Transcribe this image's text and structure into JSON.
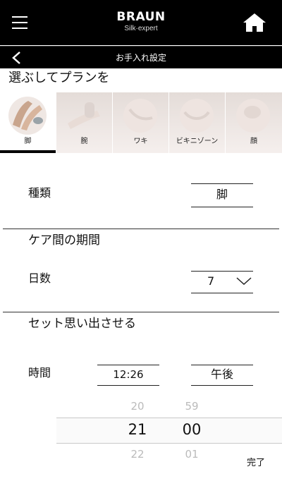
{
  "header": {
    "brand_logo": "BRAUN",
    "brand_sub": "Silk·expert",
    "subtitle": "お手入れ設定"
  },
  "plan": {
    "title": "選ぶしてプランを",
    "tabs": [
      {
        "label": "脚",
        "icon": "leg-icon",
        "active": true
      },
      {
        "label": "腕",
        "icon": "arm-icon",
        "active": false
      },
      {
        "label": "ワキ",
        "icon": "underarm-icon",
        "active": false
      },
      {
        "label": "ビキニゾーン",
        "icon": "bikini-icon",
        "active": false
      },
      {
        "label": "顔",
        "icon": "face-icon",
        "active": false
      }
    ]
  },
  "type_row": {
    "label": "種類",
    "value": "脚"
  },
  "interval": {
    "title": "ケア間の期間",
    "days_label": "日数",
    "days_value": "7"
  },
  "reminder": {
    "title": "セット思い出させる",
    "time_label": "時間",
    "time_value": "12:26",
    "ampm_value": "午後"
  },
  "time_picker": {
    "hours": [
      "20",
      "21",
      "22"
    ],
    "minutes": [
      "59",
      "00",
      "01"
    ],
    "selected_index": 1
  },
  "done_label": "完了",
  "colors": {
    "bar": "#000000",
    "tab_bg": "#ece4e1",
    "accent": "#000000"
  }
}
